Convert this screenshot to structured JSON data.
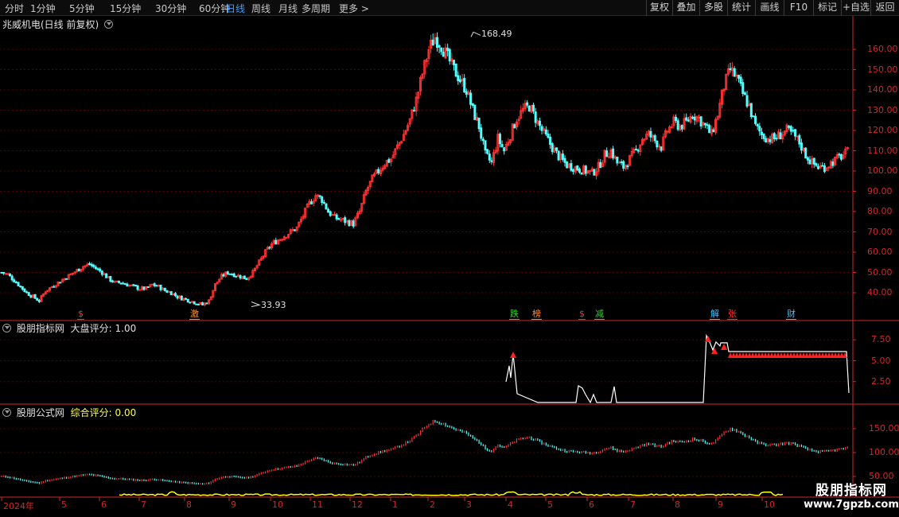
{
  "toolbar": {
    "periods": [
      "分时",
      "1分钟",
      "5分钟",
      "15分钟",
      "30分钟",
      "60分钟",
      "日线",
      "周线",
      "月线",
      "多周期",
      "更多 >"
    ],
    "active_period": "日线",
    "tools": [
      "复权",
      "叠加",
      "多股",
      "统计",
      "画线",
      "F10",
      "标记",
      "+自选",
      "返回"
    ]
  },
  "main_panel": {
    "title": "兆威机电(日线 前复权)",
    "high_label": "168.49",
    "low_label": "33.93",
    "events": [
      {
        "text": "$",
        "color": "#ff3030"
      },
      {
        "text": "激",
        "color": "#ff9030"
      },
      {
        "text": "跌",
        "color": "#30d030"
      },
      {
        "text": "榜",
        "color": "#ff9030"
      },
      {
        "text": "$",
        "color": "#ff3030"
      },
      {
        "text": "减",
        "color": "#30d030"
      },
      {
        "text": "解",
        "color": "#40c0ff"
      },
      {
        "text": "张",
        "color": "#ff3030"
      },
      {
        "text": "财",
        "color": "#40c0ff"
      }
    ]
  },
  "indicator1": {
    "name": "股朋指标网",
    "label": "大盘评分:",
    "value": "1.00"
  },
  "indicator2": {
    "name": "股朋公式网",
    "label": "综合评分:",
    "value": "0.00"
  },
  "watermark": {
    "line1": "股朋指标网",
    "line2": "www.7gpzb.com"
  },
  "colors": {
    "up": "#ff3232",
    "down": "#54ffff",
    "grid": "#5a0000",
    "axis": "#d02828",
    "score_line": "#ffffff",
    "bottom_line": "#ffff00"
  },
  "chart_data": [
    {
      "type": "candlestick",
      "series_name": "兆威机电",
      "ylim": [
        33,
        170
      ],
      "yticks": [
        "40.00",
        "50.00",
        "60.00",
        "70.00",
        "80.00",
        "90.00",
        "100.00",
        "110.00",
        "120.00",
        "130.00",
        "140.00",
        "150.00",
        "160.00"
      ],
      "xticks": [
        "2024年",
        "5",
        "6",
        "7",
        "8",
        "9",
        "10",
        "11",
        "12",
        "1",
        "2",
        "3",
        "4",
        "5",
        "6",
        "7",
        "8",
        "9",
        "10"
      ],
      "close_path": [
        50,
        49,
        46,
        43,
        40,
        38,
        36,
        41,
        43,
        45,
        47,
        49,
        51,
        53,
        54,
        52,
        50,
        47,
        45,
        45,
        44,
        43,
        42,
        42,
        44,
        43,
        41,
        40,
        38,
        37,
        36,
        35,
        34,
        36,
        44,
        48,
        50,
        49,
        48,
        47,
        50,
        55,
        60,
        64,
        66,
        68,
        70,
        72,
        78,
        84,
        88,
        86,
        80,
        77,
        76,
        75,
        74,
        80,
        90,
        96,
        100,
        104,
        106,
        112,
        118,
        125,
        135,
        148,
        160,
        166,
        162,
        156,
        150,
        145,
        140,
        130,
        122,
        108,
        104,
        116,
        110,
        118,
        126,
        130,
        132,
        126,
        120,
        115,
        110,
        106,
        103,
        102,
        101,
        100,
        99,
        102,
        108,
        110,
        104,
        102,
        106,
        110,
        116,
        118,
        115,
        112,
        120,
        124,
        122,
        124,
        128,
        126,
        122,
        118,
        128,
        142,
        150,
        146,
        138,
        132,
        122,
        118,
        116,
        116,
        118,
        120,
        118,
        114,
        108,
        104,
        102,
        102,
        104,
        106,
        108,
        110
      ]
    },
    {
      "type": "line",
      "series_name": "大盘评分",
      "yticks": [
        "2.50",
        "5.00",
        "7.50"
      ],
      "ylim": [
        0,
        9.5
      ]
    },
    {
      "type": "line",
      "series_name": "综合评分",
      "yticks": [
        "50.00",
        "100.00",
        "150.00"
      ],
      "ylim": [
        50,
        175
      ]
    }
  ]
}
